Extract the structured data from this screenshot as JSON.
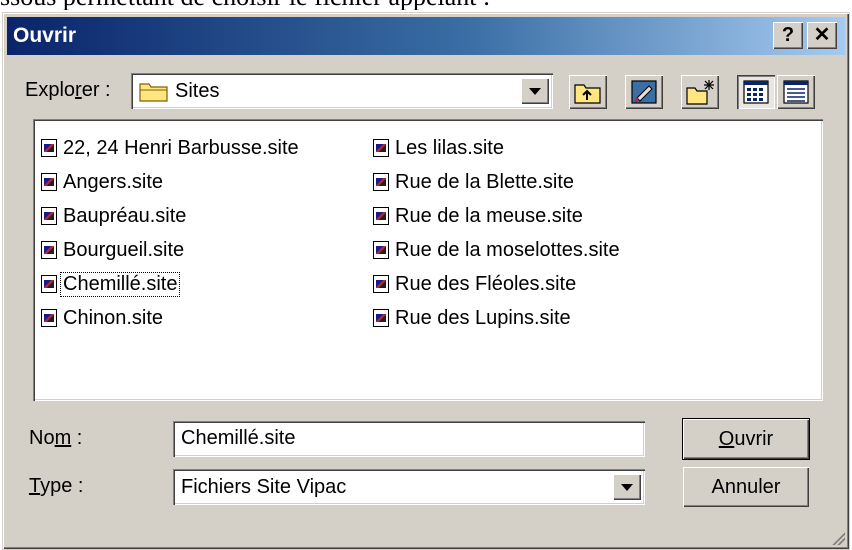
{
  "document": {
    "text_above": "ssous permettant de choisir le fichier appelant :"
  },
  "dialog": {
    "title": "Ouvrir",
    "help_label": "?",
    "close_label": "✕"
  },
  "explorer": {
    "label_pre": "Explo",
    "label_accel": "r",
    "label_post": "er :",
    "current_folder": "Sites"
  },
  "files": {
    "col1": [
      "22, 24 Henri Barbusse.site",
      "Angers.site",
      "Baupréau.site",
      "Bourgueil.site",
      "Chemillé.site",
      "Chinon.site"
    ],
    "col2": [
      "Les lilas.site",
      "Rue de la Blette.site",
      "Rue de la meuse.site",
      "Rue de la moselottes.site",
      "Rue des Fléoles.site",
      "Rue des Lupins.site"
    ],
    "focused": "Chemillé.site"
  },
  "form": {
    "name_label_pre": "No",
    "name_label_accel": "m",
    "name_label_post": " :",
    "name_value": "Chemillé.site",
    "type_label_accel": "T",
    "type_label_post": "ype :",
    "type_value": "Fichiers Site Vipac"
  },
  "buttons": {
    "open_accel": "O",
    "open_rest": "uvrir",
    "cancel": "Annuler"
  },
  "icons": {
    "folder": "folder-icon",
    "up_folder": "up-folder-icon",
    "desktop": "desktop-icon",
    "new_folder": "new-folder-icon",
    "list_view": "list-view-icon",
    "details_view": "details-view-icon",
    "file": "site-file-icon"
  }
}
